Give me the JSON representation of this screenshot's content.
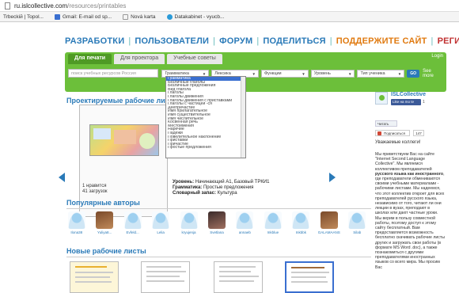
{
  "browser": {
    "url_host": "ru.islcollective.com",
    "url_path": "/resources/printables",
    "bookmarks": [
      {
        "label": "Trbeckiй | Topol...",
        "color": "#f2f2f2"
      },
      {
        "label": "Gmail: E-mail od sp...",
        "color": "#3a6fd0"
      },
      {
        "label": "Nová karta",
        "color": "#f2f2f2"
      },
      {
        "label": "Datakabinet - vyucb...",
        "color": "#2a9ad8"
      }
    ]
  },
  "nav": {
    "items": [
      "РАЗРАБОТКИ",
      "ПОЛЬЗОВАТЕЛИ",
      "ФОРУМ",
      "ПОДЕЛИТЬСЯ",
      "ПОДДЕРЖИТЕ САЙТ",
      "РЕГИСТРАЦИЯ"
    ],
    "separator": "|"
  },
  "search_panel": {
    "tabs": [
      "Для печати",
      "Для проектора",
      "Учебные советы"
    ],
    "login": "Login",
    "search_placeholder": "поиск учебных ресурсов Россия",
    "selects": [
      "Грамматика",
      "Лексика",
      "Функции",
      "Уровень",
      "Тип ученика"
    ],
    "go": "GO",
    "see_all": "See more"
  },
  "dropdown": {
    "options": [
      "Грамматика",
      "Безличные глаголы",
      "Безличные предложения",
      "Вид глагола",
      "Глаголы",
      "Глаголы движения",
      "Глаголы движения с приставками",
      "Глаголы с частицей -ся",
      "Деепричастие",
      "Имя прилагательное",
      "Имя существительное",
      "Имя числительное",
      "Косвенная речь",
      "Местоимения",
      "Наречие",
      "Падежи",
      "Повелительное наклонение",
      "Приставки",
      "Причастие",
      "Простые предложения"
    ]
  },
  "featured": {
    "title": "Проектируемые рабочие листы",
    "likes": "1 нравится",
    "downloads": "41 загрузок",
    "level_label": "Уровень:",
    "level_value": "Начинающий А1, Базовый ТРКИ1",
    "grammar_label": "Грамматика:",
    "grammar_value": "Простые предложения",
    "vocab_label": "Словарный запас:",
    "vocab_value": "Культура"
  },
  "authors": {
    "title": "Популярные авторы",
    "list": [
      {
        "name": "Ilona38",
        "avatar": "default"
      },
      {
        "name": "Yuliya8...",
        "avatar": "photo1"
      },
      {
        "name": "Evfeld...",
        "avatar": "default"
      },
      {
        "name": "Lelia",
        "avatar": "default"
      },
      {
        "name": "kryujenja",
        "avatar": "default"
      },
      {
        "name": "Svetlana",
        "avatar": "photo2"
      },
      {
        "name": "annaeb",
        "avatar": "default"
      },
      {
        "name": "Inkblue",
        "avatar": "default"
      },
      {
        "name": "Inkbbk",
        "avatar": "default"
      },
      {
        "name": "GALAMAANS",
        "avatar": "photo1"
      },
      {
        "name": "Silab",
        "avatar": "default"
      }
    ]
  },
  "new_sheets": {
    "title": "Новые рабочие листы"
  },
  "sidebar": {
    "brand": "ISLCollective",
    "fb_like": "Like на mo te",
    "fb_count": "1",
    "vk_read": "Читать",
    "subscribe": "Подписаться",
    "sub_count": "147",
    "greeting": "Уважаемые коллеги!",
    "welcome_1": "Мы приветствуем Вас на сайте \"Internet Second Language Collective\". Мы являемся коллективом преподавателей ",
    "welcome_bold": "русского языка как иностранного",
    "welcome_2": ", где преподаватели обмениваются своими учебными материалами - рабочими листами. Мы надеемся, что этот коллектив откроет для всех преподавателей русского языка, независимо от того, читают ли они лекции в вузах, преподают в школах или дают частные уроки. Мы верим в пользу совместной работы, поэтому доступ к этому сайту бесплатный. Вам предоставляется возможность бесплатно скачивать рабочие листы других и загружать свои работы (в формате MS Word .doc), а также познакомиться с другими преподавателями иностранных языков со всего мира. Мы просим Вас"
  },
  "colors": {
    "brand_blue": "#2a7ab8",
    "green_bar": "#6cbf3a",
    "orange": "#e07a10",
    "red": "#c03030"
  }
}
